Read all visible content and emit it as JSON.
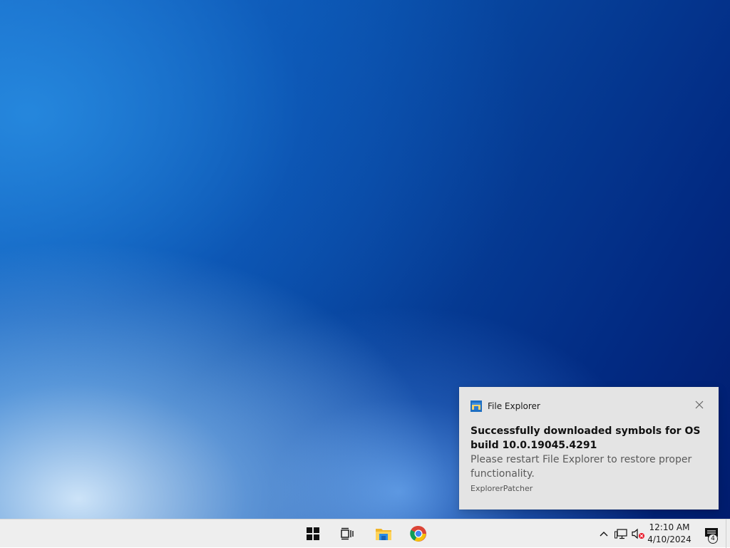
{
  "notification": {
    "app_name": "File Explorer",
    "title": "Successfully downloaded symbols for OS build 10.0.19045.4291",
    "body": "Please restart File Explorer to restore proper functionality.",
    "attribution": "ExplorerPatcher",
    "close_icon": "close-icon",
    "app_icon": "file-explorer-icon"
  },
  "taskbar": {
    "items": [
      {
        "name": "start-button",
        "icon": "windows-logo-icon"
      },
      {
        "name": "task-view-button",
        "icon": "task-view-icon"
      },
      {
        "name": "file-explorer-button",
        "icon": "folder-icon"
      },
      {
        "name": "chrome-button",
        "icon": "chrome-icon"
      }
    ],
    "tray": {
      "overflow_icon": "chevron-up-icon",
      "network_icon": "network-icon",
      "volume_icon": "volume-muted-icon"
    },
    "clock": {
      "time": "12:10 AM",
      "date": "4/10/2024"
    },
    "action_center": {
      "icon": "notification-icon",
      "count": "4"
    }
  },
  "colors": {
    "accent": "#0078d7",
    "toast_bg": "#e4e4e4",
    "taskbar_bg": "#eeeeee",
    "muted_red": "#e81123"
  }
}
